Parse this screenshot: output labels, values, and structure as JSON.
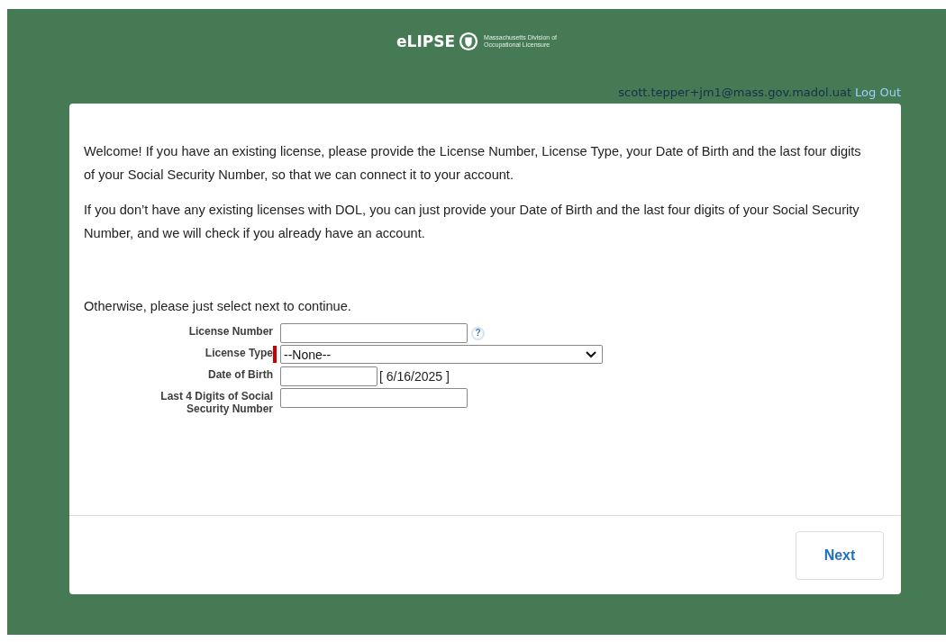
{
  "header": {
    "logo_text": "eLIPSE",
    "agency_lines": [
      "Massachusetts Division of",
      "Occupational Licensure"
    ]
  },
  "user": {
    "email": "scott.tepper+jm1@mass.gov.madol.uat",
    "logout": "Log Out"
  },
  "intro": [
    "Welcome! If you have an existing license, please provide the License Number, License Type, your Date of Birth and the last four digits of your Social Security Number, so that we can connect it to your account.",
    "If you don’t have any existing licenses with DOL, you can just provide your Date of Birth and the last four digits of your Social Security Number, and we will check if you already have an account.",
    "Otherwise, please just select next to continue."
  ],
  "fields": [
    {
      "label": "License Number",
      "kind": "text",
      "required": false,
      "help": "?"
    },
    {
      "label": "License Type",
      "kind": "select",
      "value": "--None--",
      "required": true
    },
    {
      "label": "Date of Birth",
      "kind": "date",
      "required": false,
      "hint": "[ 6/16/2025 ]"
    },
    {
      "label": "Last 4 Digits of Social Security Number",
      "kind": "text",
      "required": false
    }
  ],
  "next_button": "Next"
}
